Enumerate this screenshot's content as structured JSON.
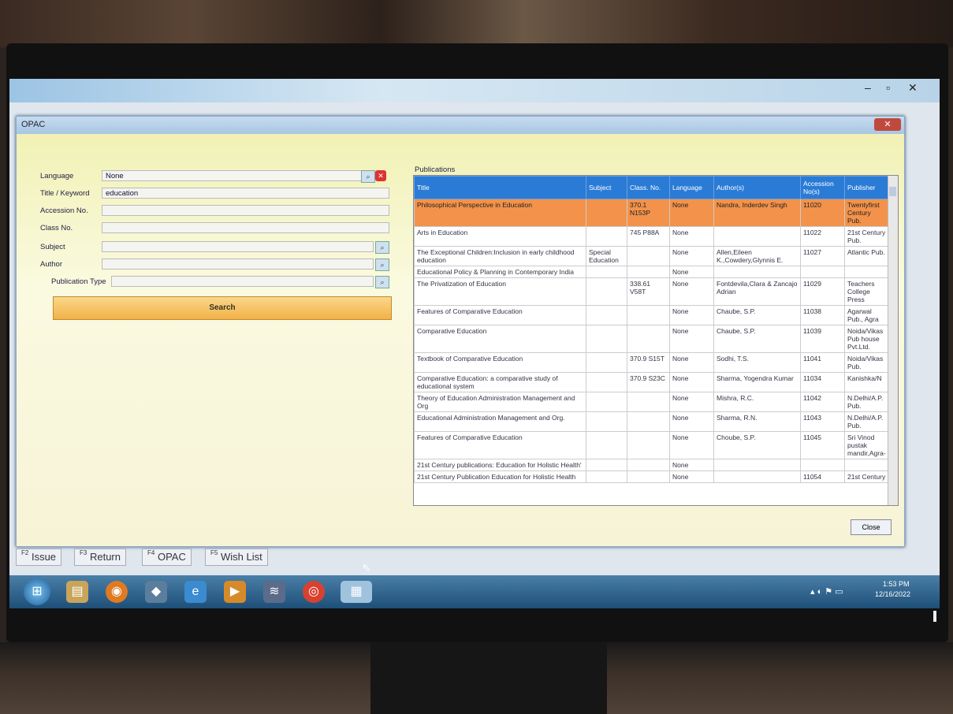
{
  "outer_window": {
    "title": "",
    "minimize": "–",
    "maximize": "▫",
    "close": "✕"
  },
  "dialog": {
    "title": "OPAC",
    "close_label": "✕"
  },
  "form": {
    "language_label": "Language",
    "language_value": "None",
    "title_label": "Title / Keyword",
    "title_value": "education",
    "accession_label": "Accession No.",
    "class_label": "Class No.",
    "subject_label": "Subject",
    "author_label": "Author",
    "pubtype_label": "Publication Type",
    "search_label": "Search"
  },
  "publications": {
    "label": "Publications",
    "columns": [
      "Title",
      "Subject",
      "Class. No.",
      "Language",
      "Author(s)",
      "Accession No(s)",
      "Publisher"
    ],
    "rows": [
      [
        "Philosophical Perspective in Education",
        "",
        "370.1 N153P",
        "None",
        "Nandra, Inderdev Singh",
        "11020",
        "Twentyfirst Century Pub."
      ],
      [
        "Arts in Education",
        "",
        "745 P88A",
        "None",
        "",
        "11022",
        "21st Century Pub."
      ],
      [
        "The Exceptional Children:Inclusion in early childhood education",
        "Special Education",
        "",
        "None",
        "Allen,Eileen K.,Cowdery,Glynnis E.",
        "11027",
        "Atlantic Pub."
      ],
      [
        "Educational Policy & Planning in Contemporary India",
        "",
        "",
        "None",
        "",
        "",
        ""
      ],
      [
        "The Privatization of Education",
        "",
        "338.61 V58T",
        "None",
        "Fontdevila,Clara & Zancajo Adrian",
        "11029",
        "Teachers College Press"
      ],
      [
        "Features of Comparative Education",
        "",
        "",
        "None",
        "Chaube, S.P.",
        "11038",
        "Agarwal Pub., Agra"
      ],
      [
        "Comparative Education",
        "",
        "",
        "None",
        "Chaube, S.P.",
        "11039",
        "Noida/Vikas Pub house Pvt.Ltd."
      ],
      [
        "Textbook of Comparative Education",
        "",
        "370.9 S15T",
        "None",
        "Sodhi, T.S.",
        "11041",
        "Noida/Vikas Pub."
      ],
      [
        "Comparative Education: a comparative study of educational system",
        "",
        "370.9 S23C",
        "None",
        "Sharma, Yogendra Kumar",
        "11034",
        "Kanishka/N"
      ],
      [
        "Theory of Education Administration Management and Org",
        "",
        "",
        "None",
        "Mishra, R.C.",
        "11042",
        "N.Delhi/A.P. Pub."
      ],
      [
        "Educational Administration Management and Org.",
        "",
        "",
        "None",
        "Sharma, R.N.",
        "11043",
        "N.Delhi/A.P. Pub."
      ],
      [
        "Features of Comparative Education",
        "",
        "",
        "None",
        "Choube, S.P.",
        "11045",
        "Sri Vinod pustak mandir,Agra-"
      ],
      [
        "21st Century publications: Education for Holistic Health'",
        "",
        "",
        "None",
        "",
        "",
        ""
      ],
      [
        "21st Century Publication Education for Holistic Health",
        "",
        "",
        "None",
        "",
        "11054",
        "21st Century"
      ]
    ],
    "selected_row": 0
  },
  "close_button": "Close",
  "fkeys": [
    {
      "key": "F2",
      "label": "Issue"
    },
    {
      "key": "F3",
      "label": "Return"
    },
    {
      "key": "F4",
      "label": "OPAC"
    },
    {
      "key": "F5",
      "label": "Wish List"
    }
  ],
  "taskbar": {
    "icons": [
      "start-orb-icon",
      "file-explorer-icon",
      "firefox-icon",
      "app-icon",
      "internet-explorer-icon",
      "media-player-icon",
      "scanner-icon",
      "chrome-icon",
      "library-app-icon"
    ],
    "time": "1:53 PM",
    "date": "12/16/2022"
  }
}
